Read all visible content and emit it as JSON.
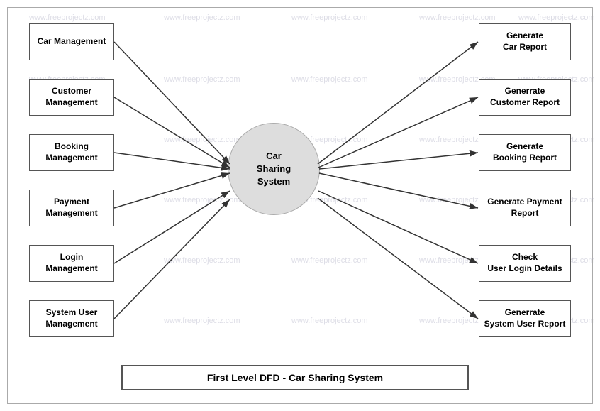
{
  "watermarks": [
    "www.freeprojectz.com",
    "www.freeprojectz.com",
    "www.freeprojectz.com",
    "www.freeprojectz.com",
    "www.freeprojectz.com",
    "www.freeprojectz.com",
    "www.freeprojectz.com",
    "www.freeprojectz.com",
    "www.freeprojectz.com",
    "www.freeprojectz.com",
    "www.freeprojectz.com",
    "www.freeprojectz.com",
    "www.freeprojectz.com",
    "www.freeprojectz.com",
    "www.freeprojectz.com",
    "www.freeprojectz.com",
    "www.freeprojectz.com",
    "www.freeprojectz.com",
    "www.freeprojectz.com",
    "www.freeprojectz.com",
    "www.freeprojectz.com",
    "www.freeprojectz.com"
  ],
  "left_boxes": [
    {
      "id": "car-management",
      "label": "Car\nManagement"
    },
    {
      "id": "customer-management",
      "label": "Customer\nManagement"
    },
    {
      "id": "booking-management",
      "label": "Booking\nManagement"
    },
    {
      "id": "payment-management",
      "label": "Payment\nManagement"
    },
    {
      "id": "login-management",
      "label": "Login\nManagement"
    },
    {
      "id": "system-user-management",
      "label": "System User\nManagement"
    }
  ],
  "right_boxes": [
    {
      "id": "generate-car-report",
      "label": "Generate\nCar Report"
    },
    {
      "id": "generate-customer-report",
      "label": "Generrate\nCustomer Report"
    },
    {
      "id": "generate-booking-report",
      "label": "Generate\nBooking Report"
    },
    {
      "id": "generate-payment-report",
      "label": "Generate\nPayment Report"
    },
    {
      "id": "check-user-login-details",
      "label": "Check\nUser Login Details"
    },
    {
      "id": "generate-system-user-report",
      "label": "Generrate\nSystem User Report"
    }
  ],
  "center": {
    "label": "Car\nSharing\nSystem"
  },
  "caption": "First Level DFD - Car Sharing System"
}
